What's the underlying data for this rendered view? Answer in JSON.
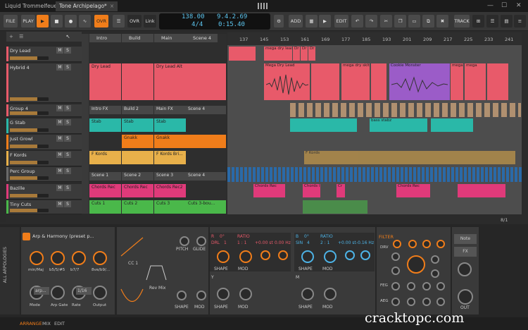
{
  "tabs": [
    {
      "label": "Liquid Trommelfeuer",
      "close": "×"
    },
    {
      "label": "Tone Archipelago*",
      "close": "×"
    }
  ],
  "window_controls": [
    "—",
    "☐",
    "✕"
  ],
  "toolbar": {
    "file": "FILE",
    "play": "PLAY",
    "ovr": "OVR",
    "ovr2": "OVR",
    "link": "Link",
    "add": "ADD",
    "edit": "EDIT",
    "track": "TRACK"
  },
  "transport": {
    "tempo": "138.00",
    "signature": "4/4",
    "position": "9.4.2.69",
    "time": "0:15.40"
  },
  "scenes": [
    "Intro",
    "Build",
    "Main",
    "Scene 4"
  ],
  "tracks": [
    {
      "name": "Dry Lead",
      "color": "#e85a6a"
    },
    {
      "name": "Hybrid 4",
      "color": "#e85a6a"
    },
    {
      "name": "Group 4",
      "color": "#e85a6a"
    },
    {
      "name": "G Stab",
      "color": "#2ab8a8"
    },
    {
      "name": "Just Growl",
      "color": "#f07d1a"
    },
    {
      "name": "F Kords",
      "color": "#e8b04a"
    },
    {
      "name": "Perc Group",
      "color": "#6a6a6a"
    },
    {
      "name": "Bazille",
      "color": "#e03a7a"
    },
    {
      "name": "Tiny Cuts",
      "color": "#4ab84a"
    }
  ],
  "ms": {
    "m": "M",
    "s": "S"
  },
  "clips": {
    "dry_lead": "Dry Lead",
    "dry_lead_alt": "Dry Lead Alt",
    "intro_fx": "Intro FX",
    "build_2": "Build 2",
    "main_fx": "Main FX",
    "scene_4": "Scene 4",
    "stab1": "Stab",
    "stab2": "Stab",
    "stab3": "Stab",
    "gnakk1": "Gnakk",
    "gnakk2": "Gnakk",
    "fkords1": "F Kords",
    "fkords2": "F Kords Bri...",
    "scene_1": "Scene 1",
    "scene_2": "Scene 2",
    "scene_3": "Scene 3",
    "scene_4b": "Scene 4",
    "chords1": "Chords Rec",
    "chords2": "Chords Rec",
    "chords3": "Chords Rec2",
    "cuts1": "Cuts 1",
    "cuts2": "Cuts 2",
    "cuts3": "Cuts 3",
    "cuts4": "Cuts 3-bou..."
  },
  "ruler": [
    "137",
    "145",
    "153",
    "161",
    "169",
    "177",
    "185",
    "193",
    "201",
    "209",
    "217",
    "225",
    "233",
    "241"
  ],
  "arrange_labels": {
    "mega_dry": "mega dry lead",
    "mega_dry2": "Mega Dry Lead",
    "dr": "Dr",
    "mega_dry_skl": "mega dry sklt",
    "cookie": "Cookie Monster",
    "mega": "mega",
    "bass": "bass stabz",
    "fkords": "F Kords",
    "chords": "Chords Rec",
    "cr": "Cr",
    "chords_i": "Chords I"
  },
  "page_indicator": "8/1",
  "device": {
    "title": "Arp & Harmony (preset p...",
    "side_label": "ALL ARPOLOGIES",
    "knobs_top": [
      "min/Maj",
      "b5/5/#5",
      "b7/7",
      "8ve/b9/..."
    ],
    "knobs_bottom": [
      "Mode",
      "Arp Gate",
      "Rate",
      "Output"
    ],
    "arp_label": "arp...",
    "rate_value": "1/16",
    "pitch": "PITCH",
    "glide": "GLIDE",
    "cc": "CC 1",
    "rev": "Rev Mix",
    "shape": "SHAPE",
    "mod": "MOD",
    "osc_r": "R",
    "osc_r_val": "0°",
    "drl": "DRL",
    "one": "1",
    "ratio": "RATIO",
    "r_val": "1 : 1",
    "r_st": "+0.00 st",
    "r_hz": "0.00 Hz",
    "osc_b": "B",
    "osc_b_val": "0°",
    "sin": "SIN",
    "four": "4",
    "b_ratio": "RATIO",
    "b_val": "2 : 1",
    "b_st": "+0.00 st",
    "b_hz": "-0.16 Hz",
    "y": "Y",
    "m": "M",
    "filter": "FILTER",
    "drv": "DRV",
    "feg": "FEG",
    "aeg": "AEG",
    "out": "OUT",
    "note": "Note",
    "fx": "FX"
  },
  "bottom_tabs": [
    "ARRANGE",
    "MIX",
    "EDIT"
  ],
  "watermark": "cracktopc.com",
  "colors": {
    "accent": "#f07d1a",
    "transport": "#5dc6f0",
    "red_clip": "#e85a6a",
    "teal": "#2ab8a8",
    "purple": "#9b5cc8"
  }
}
